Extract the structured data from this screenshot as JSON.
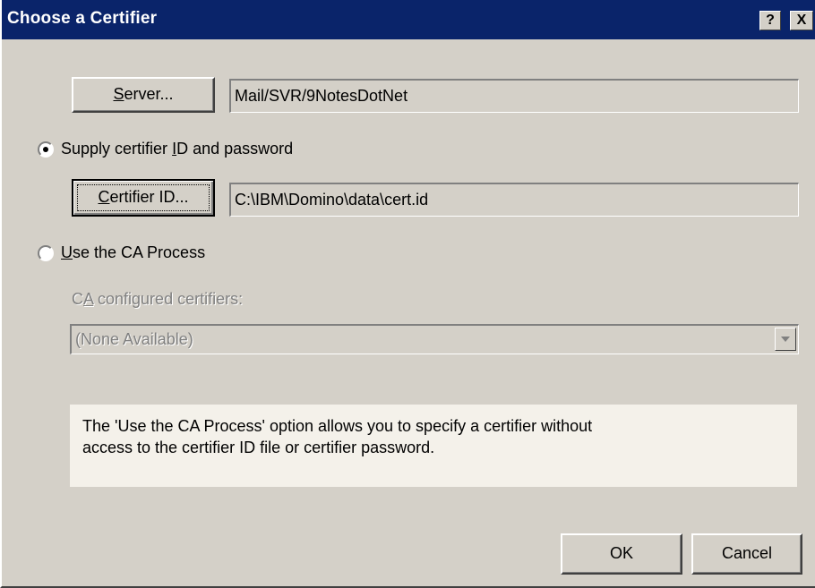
{
  "window": {
    "title": "Choose a Certifier",
    "help_label": "?",
    "close_label": "X"
  },
  "server": {
    "button_prefix": "",
    "button_mnemonic": "S",
    "button_suffix": "erver...",
    "value": "Mail/SVR/9NotesDotNet"
  },
  "option_supply": {
    "label_prefix": "Supply certifier ",
    "label_mnemonic": "I",
    "label_suffix": "D and password",
    "selected": true
  },
  "certifier": {
    "button_mnemonic": "C",
    "button_suffix": "ertifier ID...",
    "value": "C:\\IBM\\Domino\\data\\cert.id"
  },
  "option_ca": {
    "label_mnemonic": "U",
    "label_suffix": "se the CA Process",
    "selected": false
  },
  "ca_certifiers": {
    "label_prefix": "C",
    "label_mnemonic": "A",
    "label_suffix": " configured certifiers:",
    "selected_value": "(None Available)"
  },
  "info": {
    "text_line1": "The 'Use the CA Process' option allows you to specify a certifier without",
    "text_line2": "access to the certifier ID file or certifier password."
  },
  "footer": {
    "ok_label": "OK",
    "cancel_label": "Cancel"
  },
  "colors": {
    "titlebar": "#0a246a",
    "dialog_face": "#d4d0c8",
    "info_background": "#f4f1ea"
  }
}
